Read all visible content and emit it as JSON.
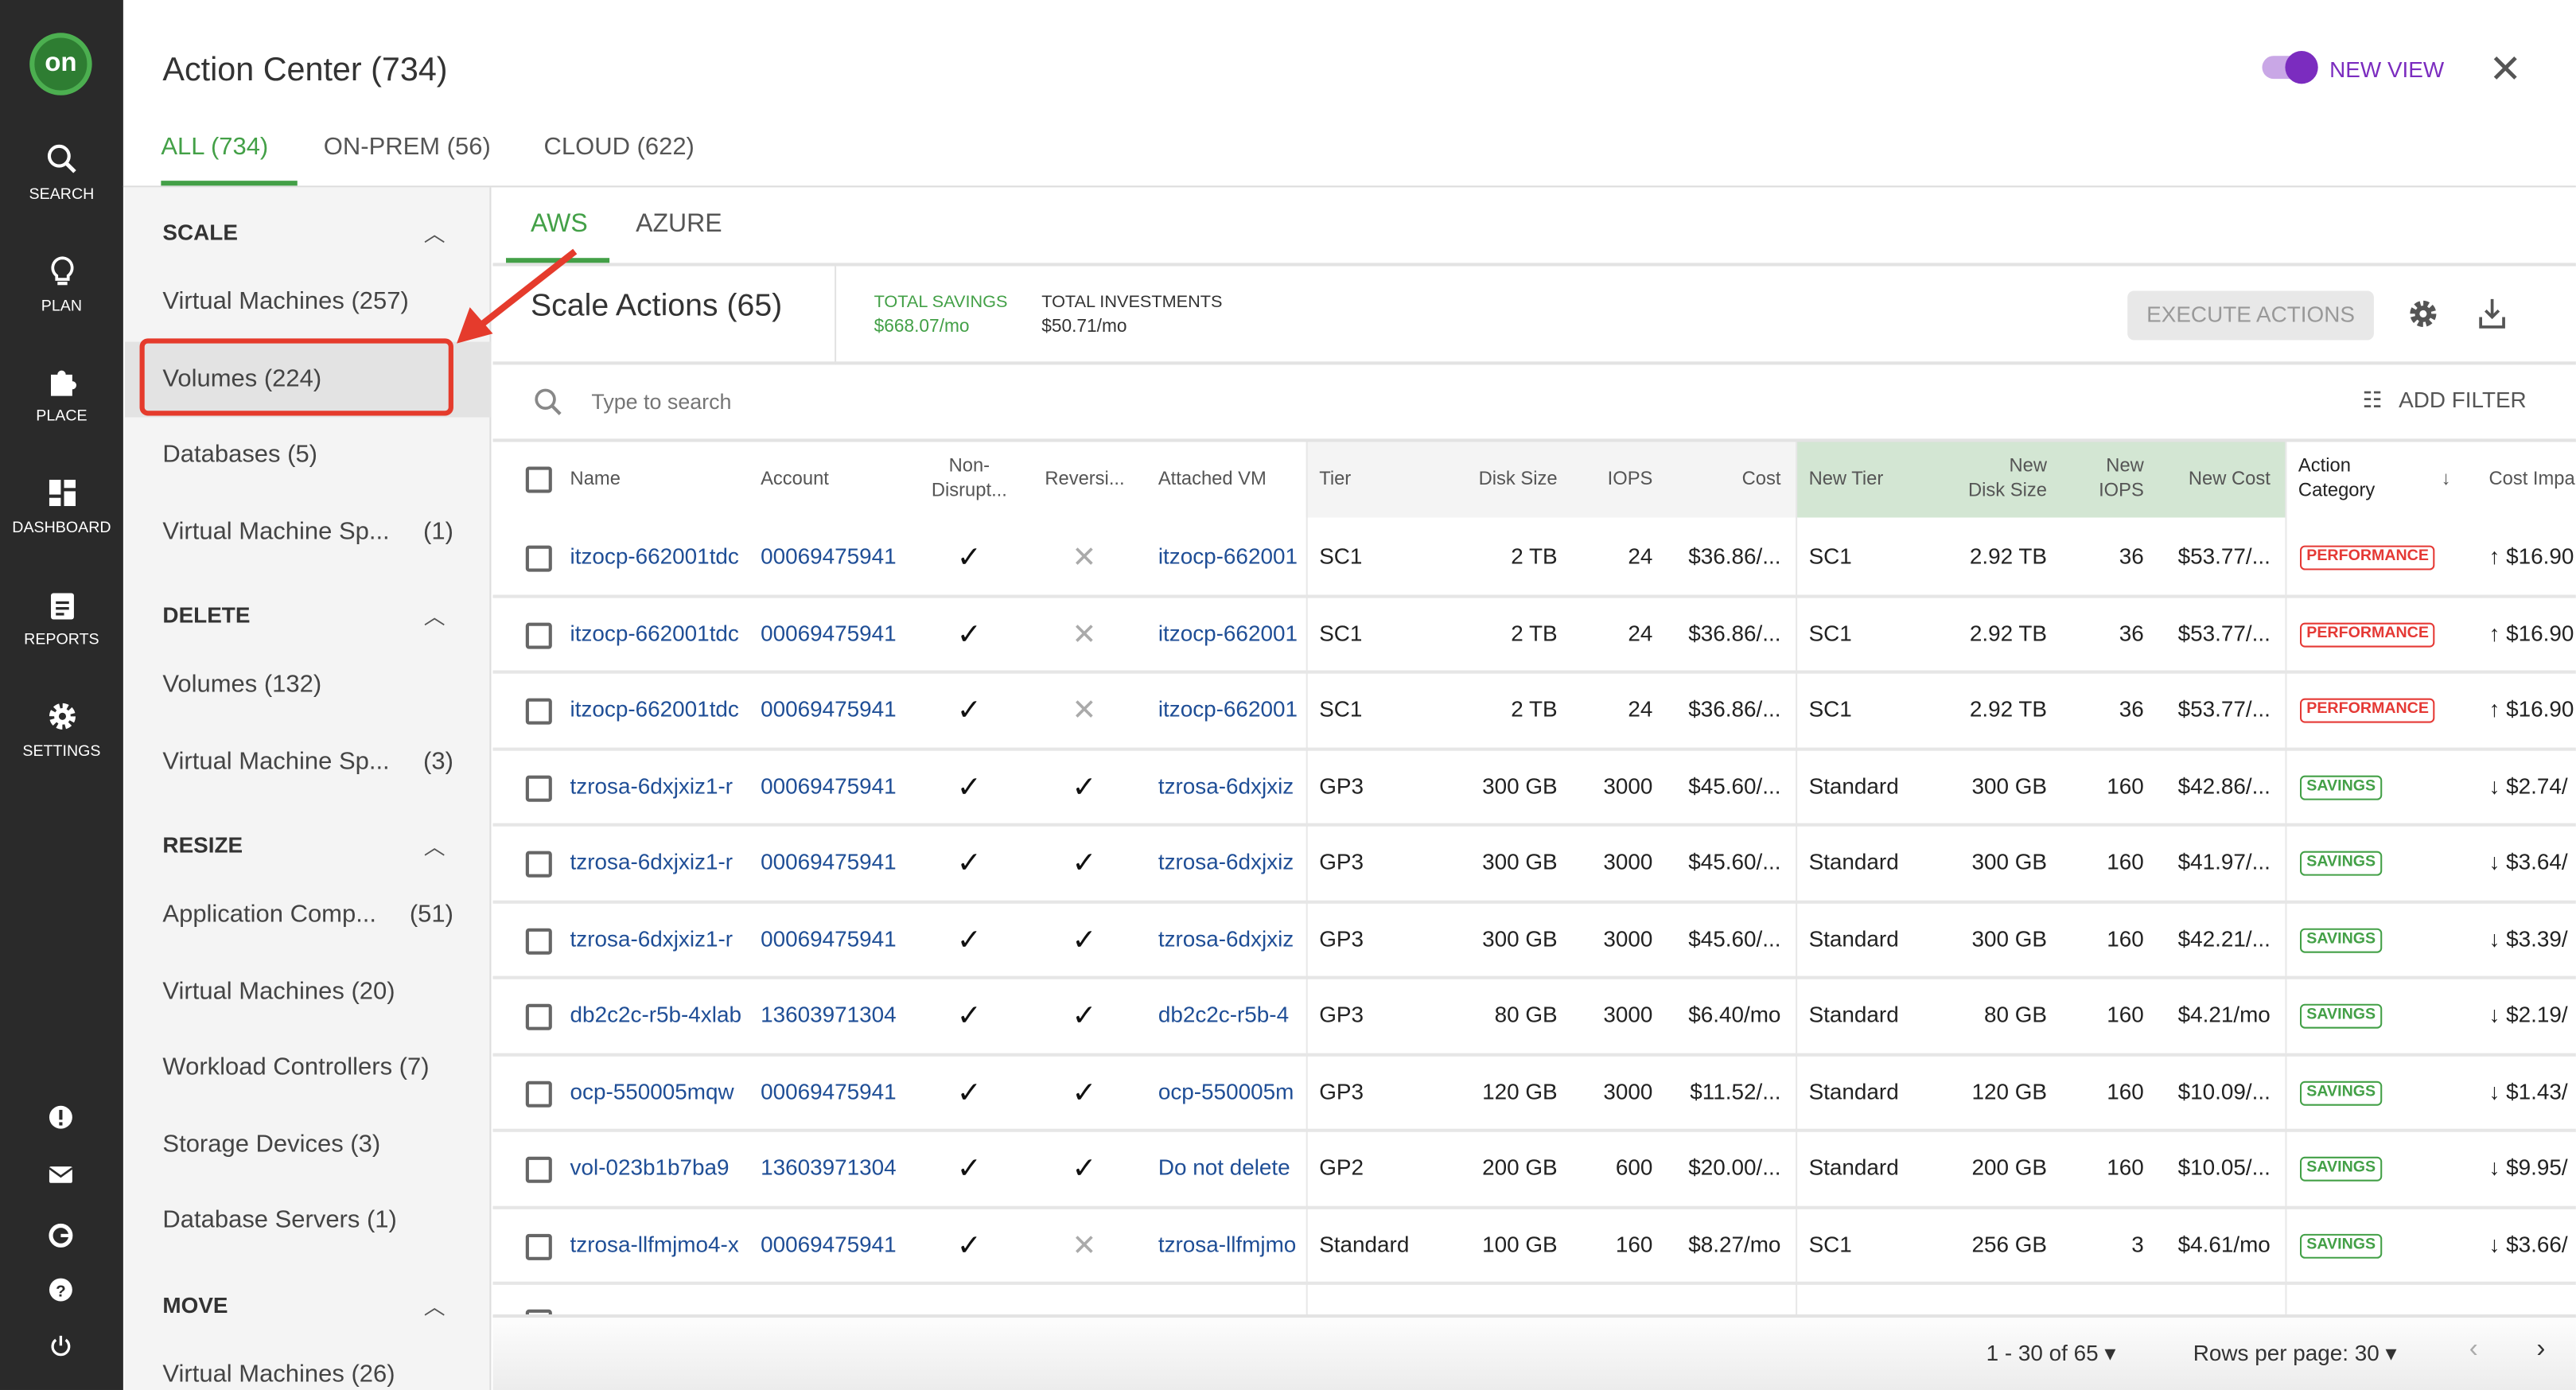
{
  "nav": {
    "logo": "on",
    "items": [
      {
        "label": "SEARCH",
        "icon": "search-icon"
      },
      {
        "label": "PLAN",
        "icon": "lightbulb-icon"
      },
      {
        "label": "PLACE",
        "icon": "puzzle-icon"
      },
      {
        "label": "DASHBOARD",
        "icon": "dashboard-icon"
      },
      {
        "label": "REPORTS",
        "icon": "clipboard-icon"
      },
      {
        "label": "SETTINGS",
        "icon": "gear-icon"
      }
    ]
  },
  "header": {
    "title": "Action Center (734)",
    "toggle_label": "NEW VIEW",
    "toggle_on": true,
    "tabs": [
      "ALL (734)",
      "ON-PREM (56)",
      "CLOUD (622)"
    ]
  },
  "sidebar": {
    "sections": [
      {
        "title": "SCALE",
        "items": [
          {
            "label": "Virtual Machines (257)",
            "count": ""
          },
          {
            "label": "Volumes (224)",
            "count": "",
            "selected": true
          },
          {
            "label": "Databases (5)",
            "count": ""
          },
          {
            "label": "Virtual Machine Sp...",
            "count": "(1)"
          }
        ]
      },
      {
        "title": "DELETE",
        "items": [
          {
            "label": "Volumes (132)",
            "count": ""
          },
          {
            "label": "Virtual Machine Sp...",
            "count": "(3)"
          }
        ]
      },
      {
        "title": "RESIZE",
        "items": [
          {
            "label": "Application Comp...",
            "count": "(51)"
          },
          {
            "label": "Virtual Machines (20)",
            "count": ""
          },
          {
            "label": "Workload Controllers (7)",
            "count": ""
          },
          {
            "label": "Storage Devices (3)",
            "count": ""
          },
          {
            "label": "Database Servers (1)",
            "count": ""
          }
        ]
      },
      {
        "title": "MOVE",
        "items": [
          {
            "label": "Virtual Machines (26)",
            "count": ""
          }
        ]
      }
    ]
  },
  "main": {
    "subtabs": [
      "AWS",
      "AZURE"
    ],
    "title": "Scale Actions (65)",
    "total_savings_label": "TOTAL SAVINGS",
    "total_savings": "$668.07/mo",
    "total_investments_label": "TOTAL INVESTMENTS",
    "total_investments": "$50.71/mo",
    "execute_label": "EXECUTE ACTIONS",
    "search_placeholder": "Type to search",
    "add_filter": "ADD FILTER",
    "columns": {
      "name": "Name",
      "account": "Account",
      "nondisrupt": "Non-\nDisrupt...",
      "reversible": "Reversi...",
      "attached": "Attached VM",
      "tier": "Tier",
      "disk": "Disk Size",
      "iops": "IOPS",
      "cost": "Cost",
      "newtier": "New Tier",
      "newdisk": "New\nDisk Size",
      "newiops": "New\nIOPS",
      "newcost": "New Cost",
      "category": "Action\nCategory",
      "impact": "Cost Impa"
    },
    "rows": [
      [
        "itzocp-662001tdc",
        "00069475941",
        "yes",
        "no",
        "itzocp-662001",
        "SC1",
        "2 TB",
        "24",
        "$36.86/...",
        "SC1",
        "2.92 TB",
        "36",
        "$53.77/...",
        "PERFORMANCE",
        "↑ $16.90"
      ],
      [
        "itzocp-662001tdc",
        "00069475941",
        "yes",
        "no",
        "itzocp-662001",
        "SC1",
        "2 TB",
        "24",
        "$36.86/...",
        "SC1",
        "2.92 TB",
        "36",
        "$53.77/...",
        "PERFORMANCE",
        "↑ $16.90"
      ],
      [
        "itzocp-662001tdc",
        "00069475941",
        "yes",
        "no",
        "itzocp-662001",
        "SC1",
        "2 TB",
        "24",
        "$36.86/...",
        "SC1",
        "2.92 TB",
        "36",
        "$53.77/...",
        "PERFORMANCE",
        "↑ $16.90"
      ],
      [
        "tzrosa-6dxjxiz1-r",
        "00069475941",
        "yes",
        "yes",
        "tzrosa-6dxjxiz",
        "GP3",
        "300 GB",
        "3000",
        "$45.60/...",
        "Standard",
        "300 GB",
        "160",
        "$42.86/...",
        "SAVINGS",
        "↓ $2.74/"
      ],
      [
        "tzrosa-6dxjxiz1-r",
        "00069475941",
        "yes",
        "yes",
        "tzrosa-6dxjxiz",
        "GP3",
        "300 GB",
        "3000",
        "$45.60/...",
        "Standard",
        "300 GB",
        "160",
        "$41.97/...",
        "SAVINGS",
        "↓ $3.64/"
      ],
      [
        "tzrosa-6dxjxiz1-r",
        "00069475941",
        "yes",
        "yes",
        "tzrosa-6dxjxiz",
        "GP3",
        "300 GB",
        "3000",
        "$45.60/...",
        "Standard",
        "300 GB",
        "160",
        "$42.21/...",
        "SAVINGS",
        "↓ $3.39/"
      ],
      [
        "db2c2c-r5b-4xlab",
        "13603971304",
        "yes",
        "yes",
        "db2c2c-r5b-4",
        "GP3",
        "80 GB",
        "3000",
        "$6.40/mo",
        "Standard",
        "80 GB",
        "160",
        "$4.21/mo",
        "SAVINGS",
        "↓ $2.19/"
      ],
      [
        "ocp-550005mqw",
        "00069475941",
        "yes",
        "yes",
        "ocp-550005m",
        "GP3",
        "120 GB",
        "3000",
        "$11.52/...",
        "Standard",
        "120 GB",
        "160",
        "$10.09/...",
        "SAVINGS",
        "↓ $1.43/"
      ],
      [
        "vol-023b1b7ba9",
        "13603971304",
        "yes",
        "yes",
        "Do not delete",
        "GP2",
        "200 GB",
        "600",
        "$20.00/...",
        "Standard",
        "200 GB",
        "160",
        "$10.05/...",
        "SAVINGS",
        "↓ $9.95/"
      ],
      [
        "tzrosa-llfmjmo4-x",
        "00069475941",
        "yes",
        "no",
        "tzrosa-llfmjmo",
        "Standard",
        "100 GB",
        "160",
        "$8.27/mo",
        "SC1",
        "256 GB",
        "3",
        "$4.61/mo",
        "SAVINGS",
        "↓ $3.66/"
      ]
    ],
    "pagination": {
      "range": "1 - 30 of 65",
      "rows_per_page": "Rows per page: 30"
    }
  },
  "colors": {
    "accent": "#43a047",
    "toggle": "#7b2cbf",
    "performance": "#e53935",
    "annotation": "#e53b2c"
  }
}
